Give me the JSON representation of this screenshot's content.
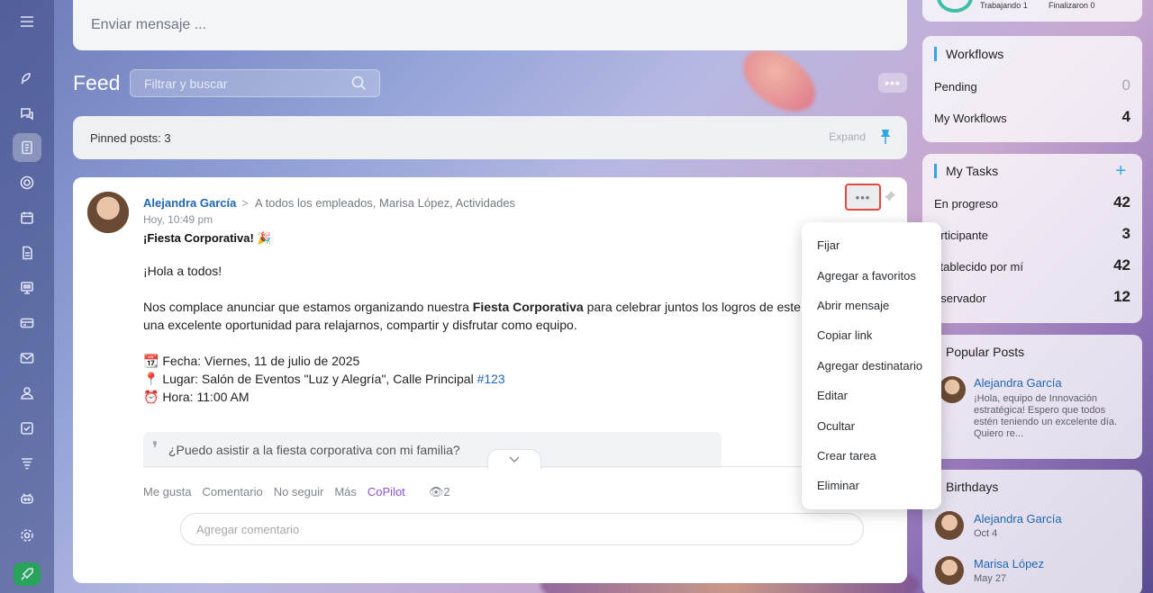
{
  "top_stats": {
    "working": "Trabajando 1",
    "finished": "Finalizaron 0"
  },
  "message_box": {
    "placeholder": "Enviar mensaje ..."
  },
  "feed": {
    "title": "Feed",
    "filter_placeholder": "Filtrar y buscar",
    "more": "•••"
  },
  "pinned": {
    "label": "Pinned posts: 3",
    "expand": "Expand"
  },
  "post": {
    "author": "Alejandra García",
    "separator": ">",
    "recipients": "A todos los empleados, Marisa López, Actividades",
    "time": "Hoy, 10:49 pm",
    "title": "¡Fiesta Corporativa! 🎉",
    "greeting": "¡Hola a todos!",
    "para1_pre": "Nos complace anunciar que estamos organizando nuestra ",
    "para1_bold": "Fiesta Corporativa",
    "para1_post": " para celebrar juntos los logros de este a",
    "para1_line2": "una excelente oportunidad para relajarnos, compartir y disfrutar como equipo.",
    "date_line": "📆 Fecha: Viernes, 11 de julio de 2025",
    "place_pre": "📍 Lugar: Salón de Eventos \"Luz y Alegría\", Calle Principal ",
    "place_tag": "#123",
    "hour_line": "⏰ Hora: 11:00 AM",
    "quote_mark": "❜",
    "quote": "¿Puedo asistir a la fiesta corporativa con mi familia?",
    "actions": {
      "like": "Me gusta",
      "comment": "Comentario",
      "unfollow": "No seguir",
      "more": "Más",
      "copilot": "CoPilot",
      "views": "2"
    },
    "comment_placeholder": "Agregar comentario",
    "more_button": "•••"
  },
  "context_menu": [
    "Fijar",
    "Agregar a favoritos",
    "Abrir mensaje",
    "Copiar link",
    "Agregar destinatario",
    "Editar",
    "Ocultar",
    "Crear tarea",
    "Eliminar"
  ],
  "workflows": {
    "title": "Workflows",
    "rows": [
      {
        "label": "Pending",
        "value": "0"
      },
      {
        "label": "My Workflows",
        "value": "4"
      }
    ]
  },
  "tasks": {
    "title": "My Tasks",
    "plus": "+",
    "rows": [
      {
        "label": "En progreso",
        "value": "42"
      },
      {
        "label": "articipante",
        "value": "3"
      },
      {
        "label": "stablecido por mí",
        "value": "42"
      },
      {
        "label": "bservador",
        "value": "12"
      }
    ]
  },
  "popular": {
    "title": "Popular Posts",
    "author": "Alejandra García",
    "text": "¡Hola, equipo de Innovación estratégica! Espero que todos estén teniendo un excelente día. Quiero re..."
  },
  "birthdays": {
    "title": "Birthdays",
    "people": [
      {
        "name": "Alejandra García",
        "date": "Oct 4"
      },
      {
        "name": "Marisa López",
        "date": "May 27"
      }
    ]
  }
}
